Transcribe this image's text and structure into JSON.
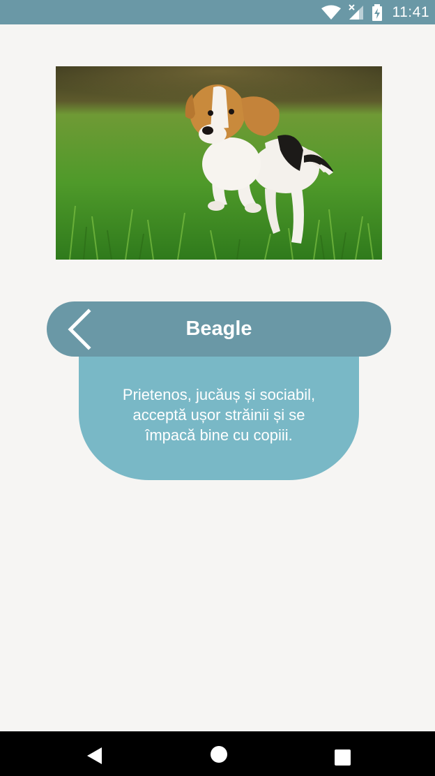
{
  "status_bar": {
    "time": "11:41",
    "icons": [
      "wifi-icon",
      "cell-signal-icon",
      "battery-charging-icon"
    ]
  },
  "photo": {
    "subject": "dog-photo"
  },
  "header": {
    "title": "Beagle",
    "back_icon": "chevron-left-icon"
  },
  "description": {
    "lines": [
      "Prietenos, jucăuș și sociabil,",
      "acceptă ușor străinii și se",
      "împacă bine cu copiii."
    ]
  },
  "nav_bar": {
    "buttons": [
      "back-icon",
      "home-icon",
      "recents-icon"
    ]
  },
  "colors": {
    "background": "#f6f5f3",
    "status_bar": "#6a98a6",
    "title_pill": "#6a98a6",
    "description_card": "#79b8c6",
    "nav_bar": "#000000",
    "text": "#ffffff"
  }
}
